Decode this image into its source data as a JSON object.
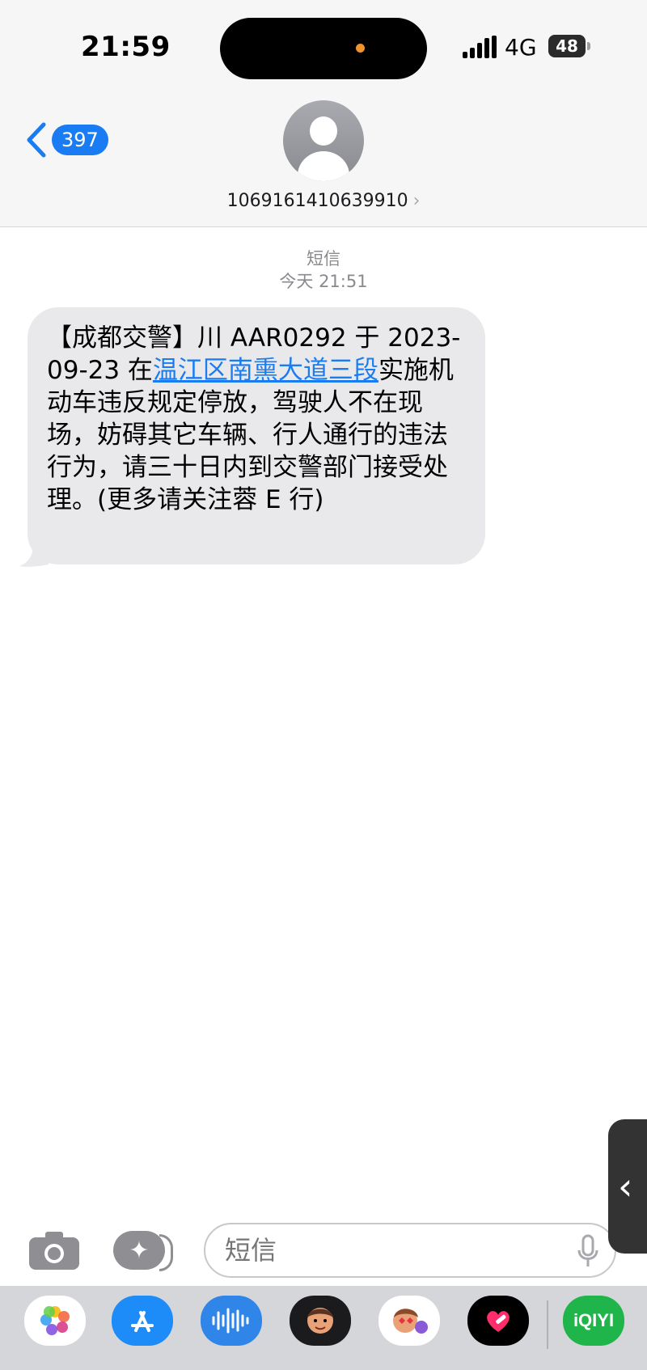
{
  "status_bar": {
    "time": "21:59",
    "network": "4G",
    "battery": "48"
  },
  "nav": {
    "back_count": "397",
    "contact": "1069161410639910",
    "contact_chevron": "›"
  },
  "thread": {
    "service": "短信",
    "timestamp": "今天 21:51",
    "message": {
      "part1": "【成都交警】川 AAR0292 于 2023-09-23 在",
      "link": "温江区南熏大道三段",
      "part2": "实施机动车违反规定停放，驾驶人不在现场，妨碍其它车辆、行人通行的违法行为，请三十日内到交警部门接受处理。(更多请关注蓉 E 行)"
    }
  },
  "composer": {
    "placeholder": "短信"
  },
  "app_drawer": {
    "apps": [
      "photos-icon",
      "app-store-icon",
      "audio-message-icon",
      "memoji-icon",
      "stickers-icon",
      "digital-touch-icon",
      "iqiyi-icon"
    ],
    "iqiyi_label": "iQIYI"
  },
  "colors": {
    "accent": "#1a7cf2",
    "bubble": "#e9e9eb",
    "header_bg": "#f6f6f7",
    "drawer_bg": "#d5d6da"
  }
}
